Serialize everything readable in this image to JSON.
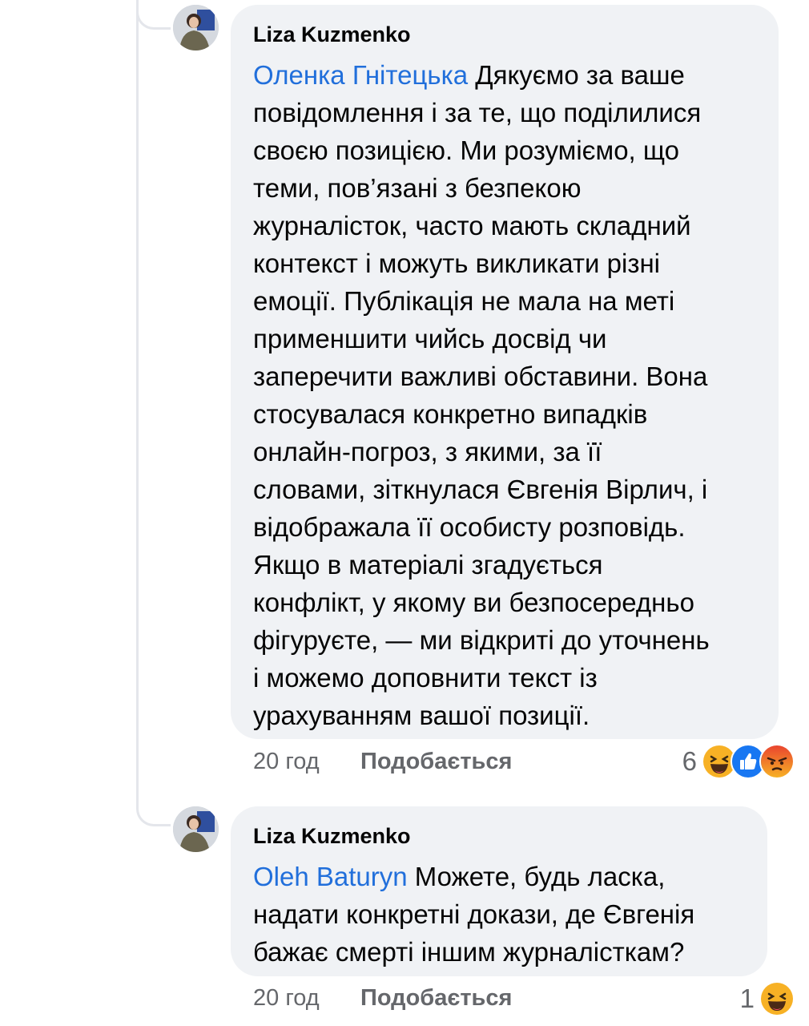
{
  "comments": [
    {
      "author": "Liza Kuzmenko",
      "mention": "Оленка Гнітецька",
      "lines": [
        " Дякуємо за ваше",
        "повідомлення і за те, що поділилися",
        "своєю позицією. Ми розуміємо, що",
        "теми, пов’язані з безпекою",
        "журналісток, часто мають складний",
        "контекст і можуть викликати різні",
        "емоції. Публікація не мала на меті",
        "применшити чийсь досвід чи",
        "заперечити важливі обставини. Вона",
        "стосувалася конкретно випадків",
        "онлайн-погроз, з якими, за її",
        "словами, зіткнулася Євгенія Вірлич, і",
        "відображала її особисту розповідь.",
        "Якщо в матеріалі згадується",
        "конфлікт, у якому ви безпосередньо",
        "фігуруєте, — ми відкриті до уточнень",
        "і можемо доповнити текст із",
        "урахуванням вашої позиції."
      ],
      "time": "20 год",
      "like_label": "Подобається",
      "reaction_count": "6",
      "reaction_icons": [
        "haha-icon",
        "like-icon",
        "angry-icon"
      ]
    },
    {
      "author": "Liza Kuzmenko",
      "mention": "Oleh Baturyn",
      "lines": [
        " Можете, будь ласка,",
        "надати конкретні докази, де Євгенія",
        "бажає смерті іншим журналісткам?"
      ],
      "time": "20 год",
      "like_label": "Подобається",
      "reaction_count": "1",
      "reaction_icons": [
        "haha-icon"
      ]
    }
  ],
  "colors": {
    "mention": "#216fdb",
    "bubble": "#f0f2f5",
    "meta_text": "#65676b",
    "like_reaction": "#1877f2",
    "haha_reaction": "#f7b125",
    "angry_reaction": "#e9710f"
  }
}
